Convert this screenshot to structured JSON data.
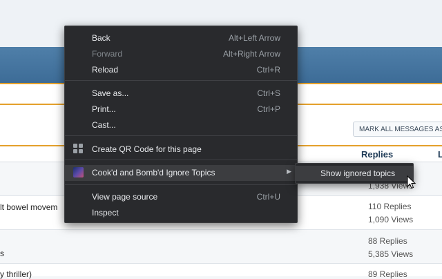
{
  "background_page": {
    "mark_button": "MARK ALL MESSAGES AS",
    "columns": {
      "replies": "Replies",
      "last": "L"
    },
    "rows": [
      {
        "title": "",
        "replies": "",
        "views": "1,938 Views"
      },
      {
        "title": "lt bowel movem",
        "replies": "110 Replies",
        "views": "1,090 Views"
      },
      {
        "title": "s",
        "replies": "88 Replies",
        "views": "5,385 Views"
      },
      {
        "title": "y thriller)",
        "replies": "89 Replies",
        "views": ""
      }
    ]
  },
  "context_menu": {
    "items": [
      {
        "label": "Back",
        "shortcut": "Alt+Left Arrow"
      },
      {
        "label": "Forward",
        "shortcut": "Alt+Right Arrow"
      },
      {
        "label": "Reload",
        "shortcut": "Ctrl+R"
      },
      {
        "label": "Save as...",
        "shortcut": "Ctrl+S"
      },
      {
        "label": "Print...",
        "shortcut": "Ctrl+P"
      },
      {
        "label": "Cast...",
        "shortcut": ""
      },
      {
        "label": "Create QR Code for this page",
        "icon": "qr-code-icon"
      },
      {
        "label": "Cook'd and Bomb'd Ignore Topics",
        "icon": "extension-icon"
      },
      {
        "label": "View page source",
        "shortcut": "Ctrl+U"
      },
      {
        "label": "Inspect",
        "shortcut": ""
      }
    ],
    "submenu": {
      "label": "Show ignored topics"
    }
  },
  "colors": {
    "menu_bg": "#292a2d",
    "banner": "#4a7aa5",
    "accent_line": "#e4a02b"
  }
}
